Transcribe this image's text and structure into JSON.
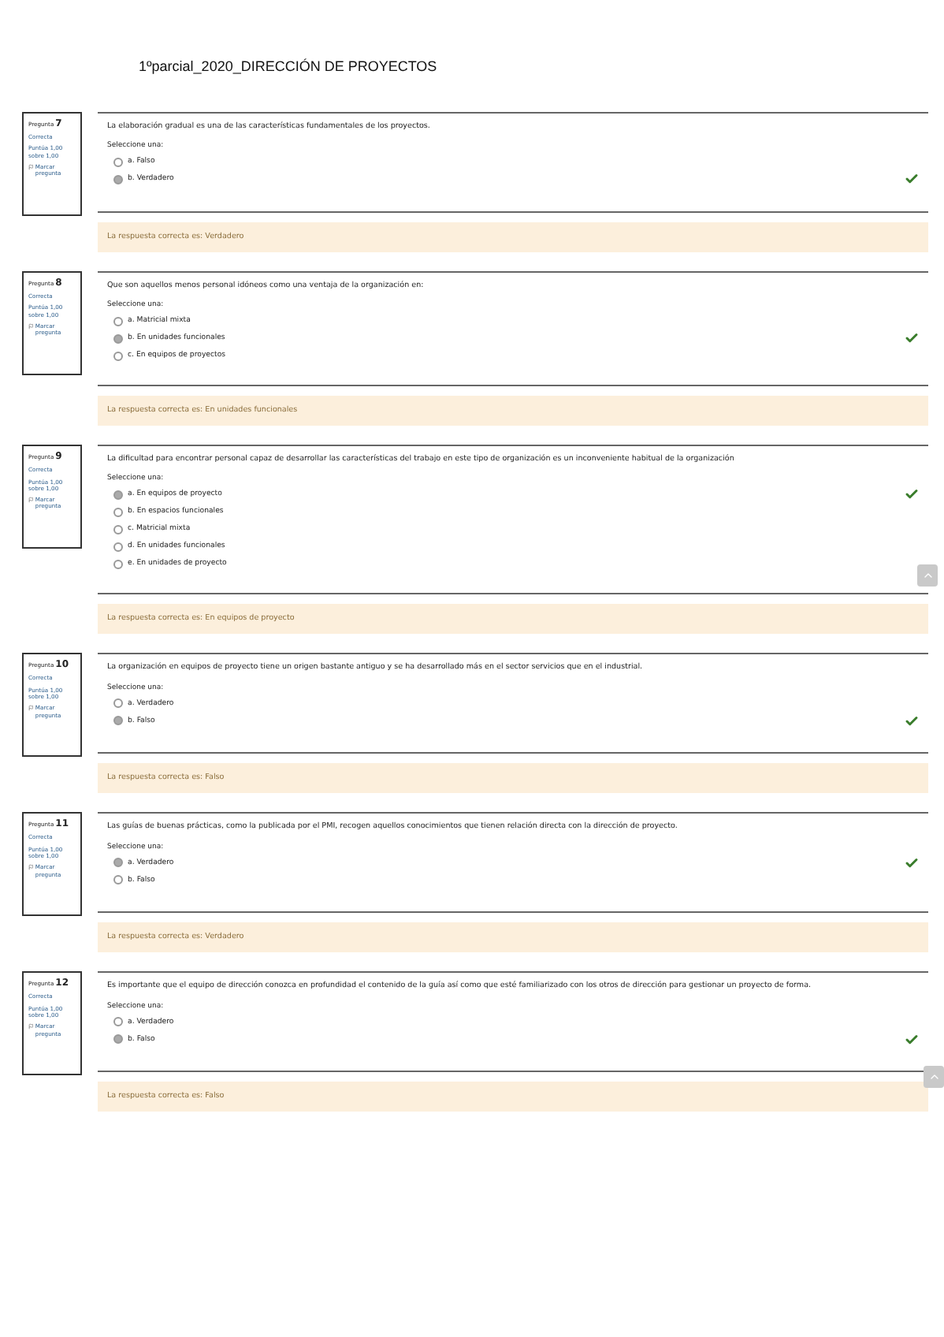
{
  "title": "1ºparcial_2020_DIRECCIÓN DE PROYECTOS",
  "questions": [
    {
      "label": "Pregunta",
      "number": "7",
      "status": "Correcta",
      "score": "Puntúa 1,00 sobre 1,00",
      "flag": "Marcar pregunta",
      "text": "La elaboración gradual es una de las características fundamentales de los proyectos.",
      "prompt": "Seleccione una:",
      "options": [
        {
          "label": "a. Falso",
          "selected": false
        },
        {
          "label": "b. Verdadero",
          "selected": true
        }
      ],
      "feedback": "La respuesta correcta es: Verdadero"
    },
    {
      "label": "Pregunta",
      "number": "8",
      "status": "Correcta",
      "score": "Puntúa 1,00 sobre 1,00",
      "flag": "Marcar pregunta",
      "text": "Que son aquellos menos personal idóneos como una ventaja de la organización en:",
      "prompt": "Seleccione una:",
      "options": [
        {
          "label": "a. Matricial mixta",
          "selected": false
        },
        {
          "label": "b. En unidades funcionales",
          "selected": true
        },
        {
          "label": "c. En equipos de proyectos",
          "selected": false
        }
      ],
      "feedback": "La respuesta correcta es: En unidades funcionales"
    },
    {
      "label": "Pregunta",
      "number": "9",
      "status": "Correcta",
      "score": "Puntúa 1,00 sobre 1,00",
      "flag": "Marcar pregunta",
      "text": "La dificultad para encontrar personal capaz de desarrollar las características del trabajo en este tipo de organización es un inconveniente habitual de la organización",
      "prompt": "Seleccione una:",
      "options": [
        {
          "label": "a. En equipos de proyecto",
          "selected": true
        },
        {
          "label": "b. En espacios funcionales",
          "selected": false
        },
        {
          "label": "c. Matricial mixta",
          "selected": false
        },
        {
          "label": "d. En unidades funcionales",
          "selected": false
        },
        {
          "label": "e. En unidades de proyecto",
          "selected": false
        }
      ],
      "feedback": "La respuesta correcta es: En equipos de proyecto"
    },
    {
      "label": "Pregunta",
      "number": "10",
      "status": "Correcta",
      "score": "Puntúa 1,00 sobre 1,00",
      "flag": "Marcar pregunta",
      "text": "La organización en equipos de proyecto tiene un origen bastante antiguo y se ha desarrollado más en el sector servicios que en el industrial.",
      "prompt": "Seleccione una:",
      "options": [
        {
          "label": "a. Verdadero",
          "selected": false
        },
        {
          "label": "b. Falso",
          "selected": true
        }
      ],
      "feedback": "La respuesta correcta es: Falso"
    },
    {
      "label": "Pregunta",
      "number": "11",
      "status": "Correcta",
      "score": "Puntúa 1,00 sobre 1,00",
      "flag": "Marcar pregunta",
      "text": "Las guías de buenas prácticas, como la publicada por el PMI, recogen aquellos conocimientos que tienen relación directa con la dirección de proyecto.",
      "prompt": "Seleccione una:",
      "options": [
        {
          "label": "a. Verdadero",
          "selected": true
        },
        {
          "label": "b. Falso",
          "selected": false
        }
      ],
      "feedback": "La respuesta correcta es: Verdadero"
    },
    {
      "label": "Pregunta",
      "number": "12",
      "status": "Correcta",
      "score": "Puntúa 1,00 sobre 1,00",
      "flag": "Marcar pregunta",
      "text": "Es importante que el equipo de dirección conozca en profundidad el contenido de la guía así como que esté familiarizado con los otros de dirección para gestionar un proyecto de forma.",
      "prompt": "Seleccione una:",
      "options": [
        {
          "label": "a. Verdadero",
          "selected": false
        },
        {
          "label": "b. Falso",
          "selected": true
        }
      ],
      "feedback": "La respuesta correcta es: Falso"
    }
  ]
}
